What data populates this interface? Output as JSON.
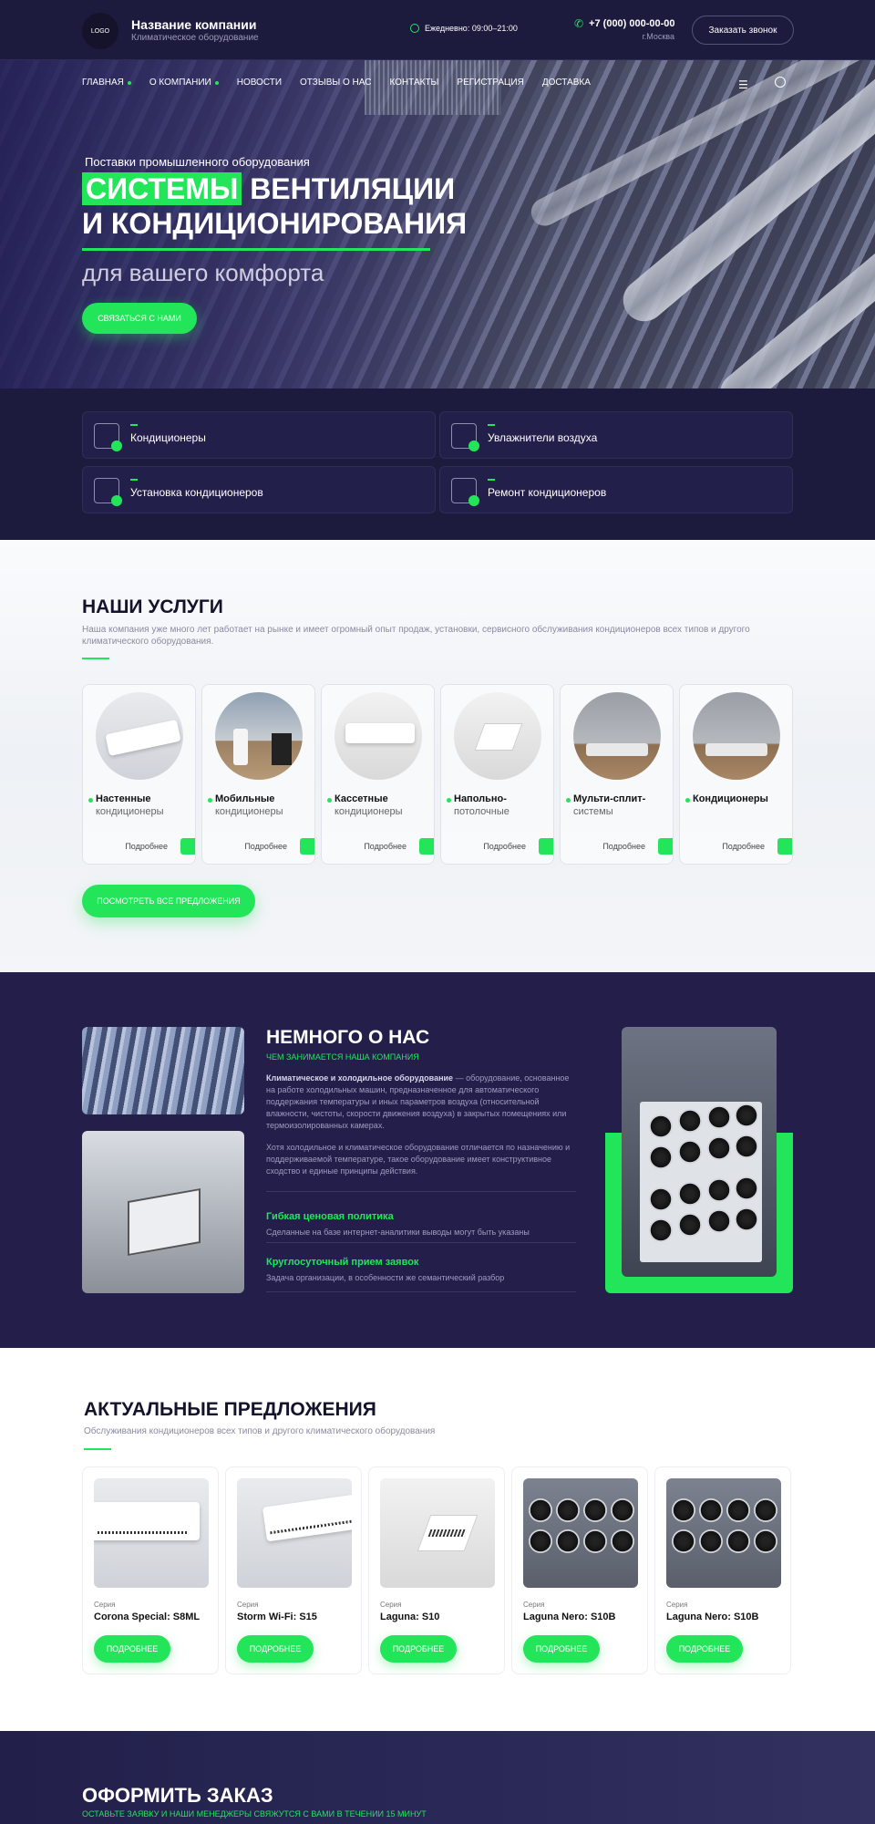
{
  "header": {
    "logo": "LOGO",
    "company_name": "Название компании",
    "company_sub": "Климатическое оборудование",
    "hours": "Ежедневно: 09:00–21:00",
    "phone": "+7 (000) 000-00-00",
    "city": "г.Москва",
    "callback": "Заказать звонок"
  },
  "nav": {
    "items": [
      "ГЛАВНАЯ",
      "О КОМПАНИИ",
      "НОВОСТИ",
      "ОТЗЫВЫ О НАС",
      "КОНТАКТЫ",
      "РЕГИСТРАЦИЯ",
      "ДОСТАВКА"
    ],
    "menu_icon": "hamburger-icon",
    "search_icon": "search-icon"
  },
  "hero": {
    "kicker": "Поставки промышленного оборудования",
    "title_highlight": "СИСТЕМЫ",
    "title_rest": "ВЕНТИЛЯЦИИ И КОНДИЦИОНИРОВАНИЯ",
    "subtitle": "для вашего комфорта",
    "button": "СВЯЗАТЬСЯ С НАМИ"
  },
  "categories": [
    "Кондиционеры",
    "Увлажнители воздуха",
    "Установка кондиционеров",
    "Ремонт кондиционеров"
  ],
  "services": {
    "title": "НАШИ УСЛУГИ",
    "description": "Наша компания уже много лет работает на рынке и имеет огромный опыт продаж, установки, сервисного обслуживания кондиционеров всех типов и другого климатического оборудования.",
    "cards": [
      {
        "name": "Настенные",
        "sub": "кондиционеры",
        "more": "Подробнее"
      },
      {
        "name": "Мобильные",
        "sub": "кондиционеры",
        "more": "Подробнее"
      },
      {
        "name": "Кассетные",
        "sub": "кондиционеры",
        "more": "Подробнее"
      },
      {
        "name": "Напольно-",
        "sub": "потолочные",
        "more": "Подробнее"
      },
      {
        "name": "Мульти-сплит-",
        "sub": "системы",
        "more": "Подробнее"
      },
      {
        "name": "Кондиционеры",
        "sub": "",
        "more": "Подробнее"
      }
    ],
    "all_button": "ПОСМОТРЕТЬ ВСЕ ПРЕДЛОЖЕНИЯ"
  },
  "about": {
    "title": "НЕМНОГО О НАС",
    "kicker": "ЧЕМ ЗАНИМАЕТСЯ НАША КОМПАНИЯ",
    "p1_bold": "Климатическое и холодильное оборудование",
    "p1_rest": " — оборудование, основанное на работе холодильных машин, предназначенное для автоматического поддержания температуры и иных параметров воздуха (относительной влажности, чистоты, скорости движения воздуха) в закрытых помещениях или термоизолированных камерах.",
    "p2": "Хотя холодильное и климатическое оборудование отличается по назначению и поддерживаемой температуре, такое оборудование имеет конструктивное сходство и единые принципы действия.",
    "features": [
      {
        "title": "Гибкая ценовая политика",
        "desc": "Сделанные на базе интернет-аналитики выводы могут быть указаны"
      },
      {
        "title": "Круглосуточный прием заявок",
        "desc": "Задача организации, в особенности же семантический разбор"
      }
    ]
  },
  "offers": {
    "title": "АКТУАЛЬНЫЕ ПРЕДЛОЖЕНИЯ",
    "description": "Обслуживания кондиционеров всех типов и другого климатического оборудования",
    "items": [
      {
        "series": "Серия",
        "name": "Corona Special: S8ML",
        "button": "ПОДРОБНЕЕ"
      },
      {
        "series": "Серия",
        "name": "Storm Wi-Fi: S15",
        "button": "ПОДРОБНЕЕ"
      },
      {
        "series": "Серия",
        "name": "Laguna: S10",
        "button": "ПОДРОБНЕЕ"
      },
      {
        "series": "Серия",
        "name": "Laguna Nero: S10B",
        "button": "ПОДРОБНЕЕ"
      },
      {
        "series": "Серия",
        "name": "Laguna Nero: S10B",
        "button": "ПОДРОБНЕЕ"
      }
    ]
  },
  "order": {
    "title": "ОФОРМИТЬ ЗАКАЗ",
    "kicker": "ОСТАВЬТЕ ЗАЯВКУ И НАШИ МЕНЕДЖЕРЫ СВЯЖУТСЯ С ВАМИ В ТЕЧЕНИИ 15 МИНУТ"
  },
  "colors": {
    "accent": "#22e55a",
    "dark": "#1d1b3d"
  }
}
